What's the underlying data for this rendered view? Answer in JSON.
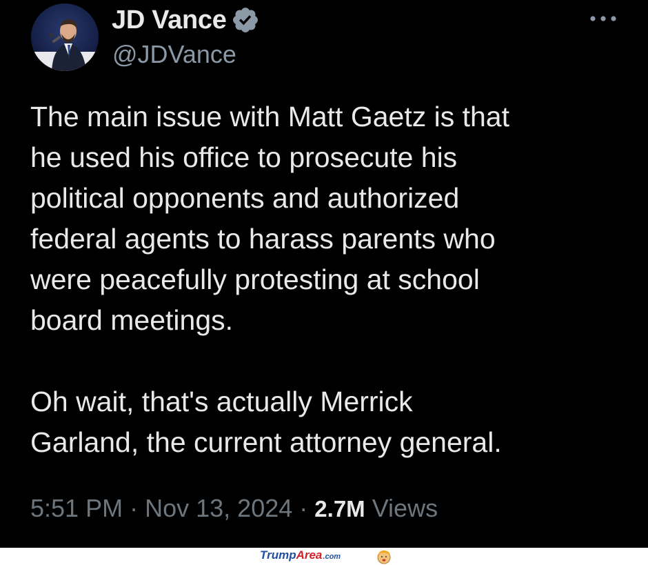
{
  "author": {
    "display_name": "JD Vance",
    "handle": "@JDVance",
    "avatar_icon": "profile-photo",
    "verified_icon": "verified-badge-icon"
  },
  "menu": {
    "icon": "more-options-icon"
  },
  "tweet": {
    "paragraph_1": "The main issue with Matt Gaetz is that\nhe used his office to prosecute his\npolitical opponents and authorized\nfederal agents to harass parents who\nwere peacefully protesting at school\nboard meetings.",
    "paragraph_2": "Oh wait, that's actually Merrick\nGarland, the current attorney general."
  },
  "meta": {
    "time": "5:51 PM",
    "separator": "·",
    "date": "Nov 13, 2024",
    "views_count": "2.7M",
    "views_label": "Views"
  },
  "watermark": {
    "part_1": "Trump",
    "part_2": "Area",
    "part_3": ".com"
  },
  "colors": {
    "background": "#000000",
    "text_primary": "#e7e9ea",
    "text_secondary": "#6e767d",
    "handle": "#8b98a5",
    "verified": "#8b98a5"
  }
}
